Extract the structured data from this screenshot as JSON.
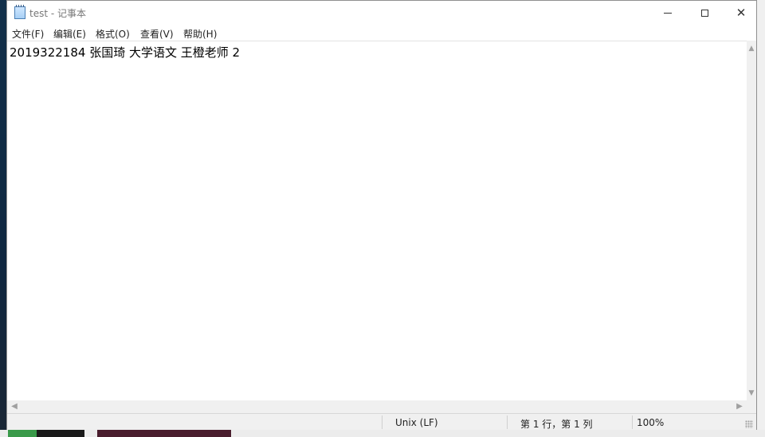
{
  "window": {
    "title": "test - 记事本",
    "minimize_glyph": "—",
    "close_glyph": "✕"
  },
  "menu": {
    "items": [
      {
        "label": "文件(F)"
      },
      {
        "label": "编辑(E)"
      },
      {
        "label": "格式(O)"
      },
      {
        "label": "查看(V)"
      },
      {
        "label": "帮助(H)"
      }
    ]
  },
  "editor": {
    "content": "2019322184 张国琦 大学语文 王橙老师 2"
  },
  "statusbar": {
    "line_ending": "Unix (LF)",
    "cursor_position": "第 1 行，第 1 列",
    "zoom": "100%"
  },
  "icons": {
    "app": "notepad-icon",
    "scroll_up": "chevron-up-icon",
    "scroll_down": "chevron-down-icon",
    "scroll_left": "chevron-left-icon",
    "scroll_right": "chevron-right-icon"
  }
}
